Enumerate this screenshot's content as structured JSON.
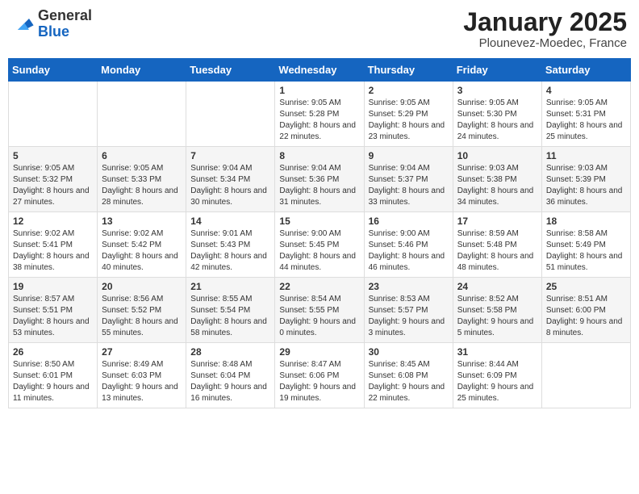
{
  "header": {
    "logo_general": "General",
    "logo_blue": "Blue",
    "month_title": "January 2025",
    "location": "Plounevez-Moedec, France"
  },
  "weekdays": [
    "Sunday",
    "Monday",
    "Tuesday",
    "Wednesday",
    "Thursday",
    "Friday",
    "Saturday"
  ],
  "weeks": [
    [
      {
        "day": "",
        "info": ""
      },
      {
        "day": "",
        "info": ""
      },
      {
        "day": "",
        "info": ""
      },
      {
        "day": "1",
        "info": "Sunrise: 9:05 AM\nSunset: 5:28 PM\nDaylight: 8 hours and 22 minutes."
      },
      {
        "day": "2",
        "info": "Sunrise: 9:05 AM\nSunset: 5:29 PM\nDaylight: 8 hours and 23 minutes."
      },
      {
        "day": "3",
        "info": "Sunrise: 9:05 AM\nSunset: 5:30 PM\nDaylight: 8 hours and 24 minutes."
      },
      {
        "day": "4",
        "info": "Sunrise: 9:05 AM\nSunset: 5:31 PM\nDaylight: 8 hours and 25 minutes."
      }
    ],
    [
      {
        "day": "5",
        "info": "Sunrise: 9:05 AM\nSunset: 5:32 PM\nDaylight: 8 hours and 27 minutes."
      },
      {
        "day": "6",
        "info": "Sunrise: 9:05 AM\nSunset: 5:33 PM\nDaylight: 8 hours and 28 minutes."
      },
      {
        "day": "7",
        "info": "Sunrise: 9:04 AM\nSunset: 5:34 PM\nDaylight: 8 hours and 30 minutes."
      },
      {
        "day": "8",
        "info": "Sunrise: 9:04 AM\nSunset: 5:36 PM\nDaylight: 8 hours and 31 minutes."
      },
      {
        "day": "9",
        "info": "Sunrise: 9:04 AM\nSunset: 5:37 PM\nDaylight: 8 hours and 33 minutes."
      },
      {
        "day": "10",
        "info": "Sunrise: 9:03 AM\nSunset: 5:38 PM\nDaylight: 8 hours and 34 minutes."
      },
      {
        "day": "11",
        "info": "Sunrise: 9:03 AM\nSunset: 5:39 PM\nDaylight: 8 hours and 36 minutes."
      }
    ],
    [
      {
        "day": "12",
        "info": "Sunrise: 9:02 AM\nSunset: 5:41 PM\nDaylight: 8 hours and 38 minutes."
      },
      {
        "day": "13",
        "info": "Sunrise: 9:02 AM\nSunset: 5:42 PM\nDaylight: 8 hours and 40 minutes."
      },
      {
        "day": "14",
        "info": "Sunrise: 9:01 AM\nSunset: 5:43 PM\nDaylight: 8 hours and 42 minutes."
      },
      {
        "day": "15",
        "info": "Sunrise: 9:00 AM\nSunset: 5:45 PM\nDaylight: 8 hours and 44 minutes."
      },
      {
        "day": "16",
        "info": "Sunrise: 9:00 AM\nSunset: 5:46 PM\nDaylight: 8 hours and 46 minutes."
      },
      {
        "day": "17",
        "info": "Sunrise: 8:59 AM\nSunset: 5:48 PM\nDaylight: 8 hours and 48 minutes."
      },
      {
        "day": "18",
        "info": "Sunrise: 8:58 AM\nSunset: 5:49 PM\nDaylight: 8 hours and 51 minutes."
      }
    ],
    [
      {
        "day": "19",
        "info": "Sunrise: 8:57 AM\nSunset: 5:51 PM\nDaylight: 8 hours and 53 minutes."
      },
      {
        "day": "20",
        "info": "Sunrise: 8:56 AM\nSunset: 5:52 PM\nDaylight: 8 hours and 55 minutes."
      },
      {
        "day": "21",
        "info": "Sunrise: 8:55 AM\nSunset: 5:54 PM\nDaylight: 8 hours and 58 minutes."
      },
      {
        "day": "22",
        "info": "Sunrise: 8:54 AM\nSunset: 5:55 PM\nDaylight: 9 hours and 0 minutes."
      },
      {
        "day": "23",
        "info": "Sunrise: 8:53 AM\nSunset: 5:57 PM\nDaylight: 9 hours and 3 minutes."
      },
      {
        "day": "24",
        "info": "Sunrise: 8:52 AM\nSunset: 5:58 PM\nDaylight: 9 hours and 5 minutes."
      },
      {
        "day": "25",
        "info": "Sunrise: 8:51 AM\nSunset: 6:00 PM\nDaylight: 9 hours and 8 minutes."
      }
    ],
    [
      {
        "day": "26",
        "info": "Sunrise: 8:50 AM\nSunset: 6:01 PM\nDaylight: 9 hours and 11 minutes."
      },
      {
        "day": "27",
        "info": "Sunrise: 8:49 AM\nSunset: 6:03 PM\nDaylight: 9 hours and 13 minutes."
      },
      {
        "day": "28",
        "info": "Sunrise: 8:48 AM\nSunset: 6:04 PM\nDaylight: 9 hours and 16 minutes."
      },
      {
        "day": "29",
        "info": "Sunrise: 8:47 AM\nSunset: 6:06 PM\nDaylight: 9 hours and 19 minutes."
      },
      {
        "day": "30",
        "info": "Sunrise: 8:45 AM\nSunset: 6:08 PM\nDaylight: 9 hours and 22 minutes."
      },
      {
        "day": "31",
        "info": "Sunrise: 8:44 AM\nSunset: 6:09 PM\nDaylight: 9 hours and 25 minutes."
      },
      {
        "day": "",
        "info": ""
      }
    ]
  ]
}
